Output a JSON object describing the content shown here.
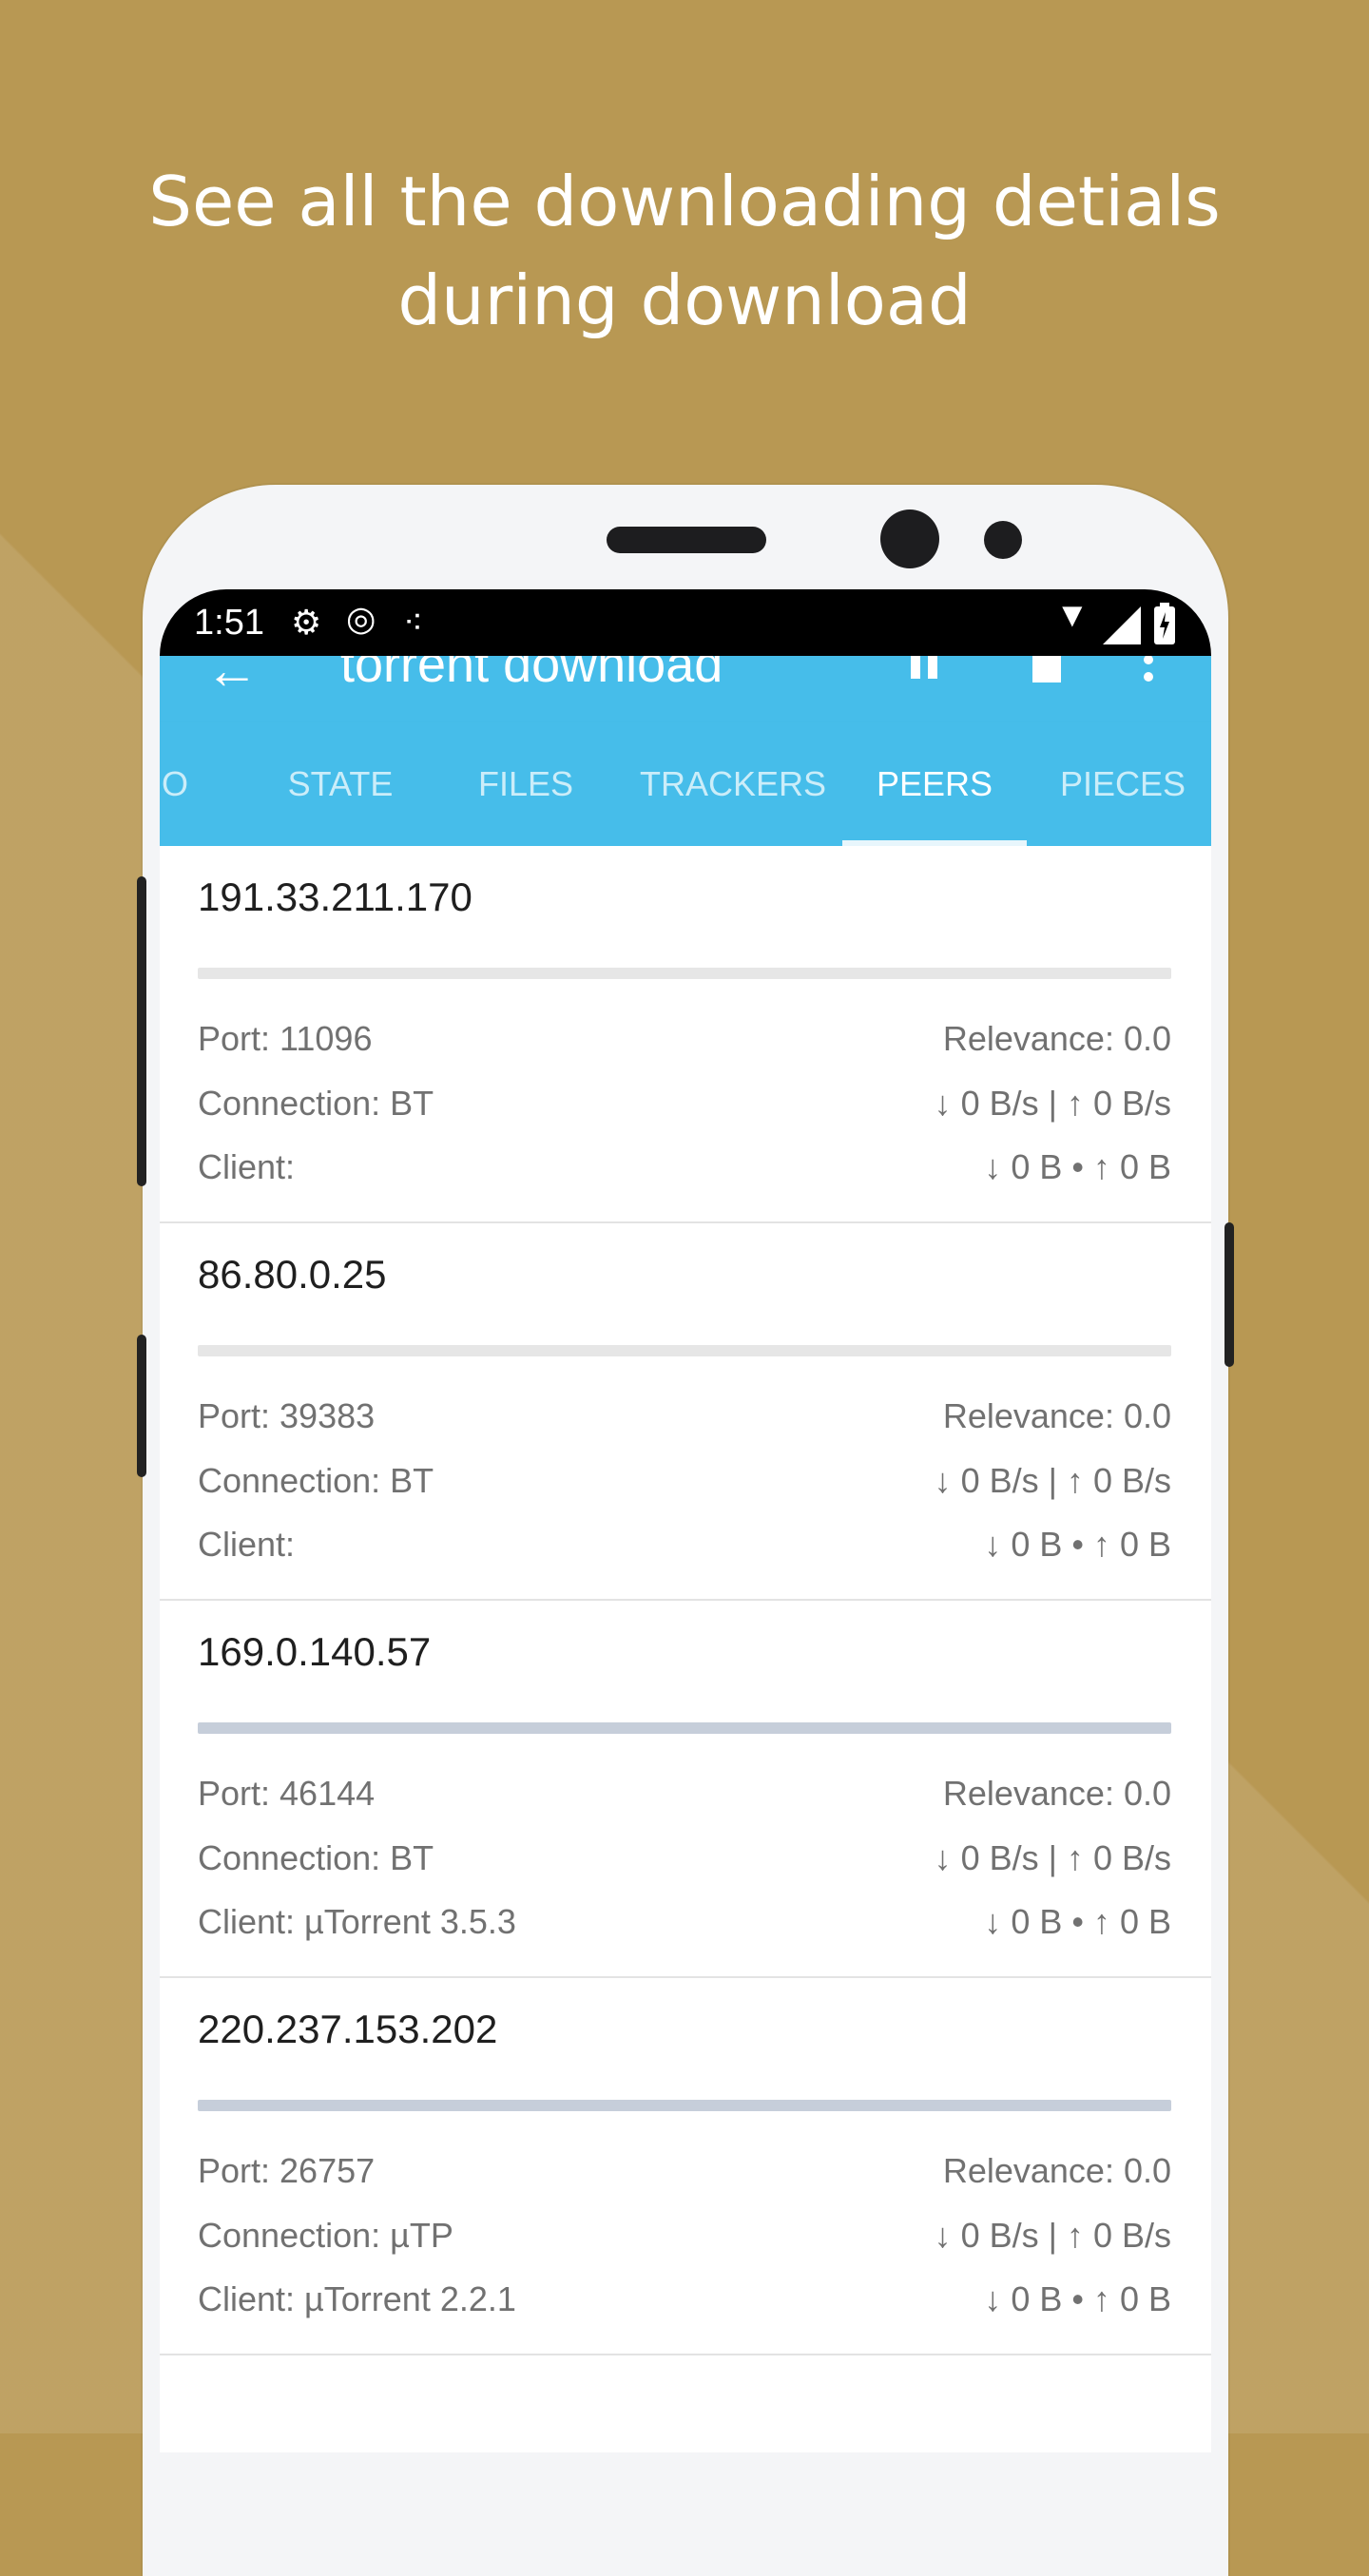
{
  "headline": {
    "line1": "See all the downloading detials",
    "line2": "during download"
  },
  "statusbar": {
    "time": "1:51",
    "icons": [
      "gear-icon",
      "globe-icon",
      "dots-icon",
      "wifi-icon",
      "signal-icon",
      "battery-icon"
    ]
  },
  "appbar": {
    "title": "torrent download",
    "icons": [
      "back-arrow-icon",
      "pause-icon",
      "stop-icon",
      "more-vert-icon"
    ]
  },
  "tabs": [
    {
      "label": "O"
    },
    {
      "label": "STATE"
    },
    {
      "label": "FILES"
    },
    {
      "label": "TRACKERS"
    },
    {
      "label": "PEERS",
      "active": true
    },
    {
      "label": "PIECES"
    }
  ],
  "peers": [
    {
      "ip": "191.33.211.170",
      "progress": 0,
      "port": "Port: 11096",
      "relevance": "Relevance: 0.0",
      "connection": "Connection: BT",
      "speed": "↓ 0 B/s | ↑ 0 B/s",
      "client": "Client:",
      "transfer": "↓ 0 B • ↑ 0 B"
    },
    {
      "ip": "86.80.0.25",
      "progress": 0,
      "port": "Port: 39383",
      "relevance": "Relevance: 0.0",
      "connection": "Connection: BT",
      "speed": "↓ 0 B/s | ↑ 0 B/s",
      "client": "Client:",
      "transfer": "↓ 0 B • ↑ 0 B"
    },
    {
      "ip": "169.0.140.57",
      "progress": 1,
      "port": "Port: 46144",
      "relevance": "Relevance: 0.0",
      "connection": "Connection: BT",
      "speed": "↓ 0 B/s | ↑ 0 B/s",
      "client": "Client: µTorrent 3.5.3",
      "transfer": "↓ 0 B • ↑ 0 B"
    },
    {
      "ip": "220.237.153.202",
      "progress": 1,
      "port": "Port: 26757",
      "relevance": "Relevance: 0.0",
      "connection": "Connection: µTP",
      "speed": "↓ 0 B/s | ↑ 0 B/s",
      "client": "Client: µTorrent 2.2.1",
      "transfer": "↓ 0 B • ↑ 0 B"
    }
  ],
  "colors": {
    "background": "#b89853",
    "accent": "#46bdea"
  }
}
